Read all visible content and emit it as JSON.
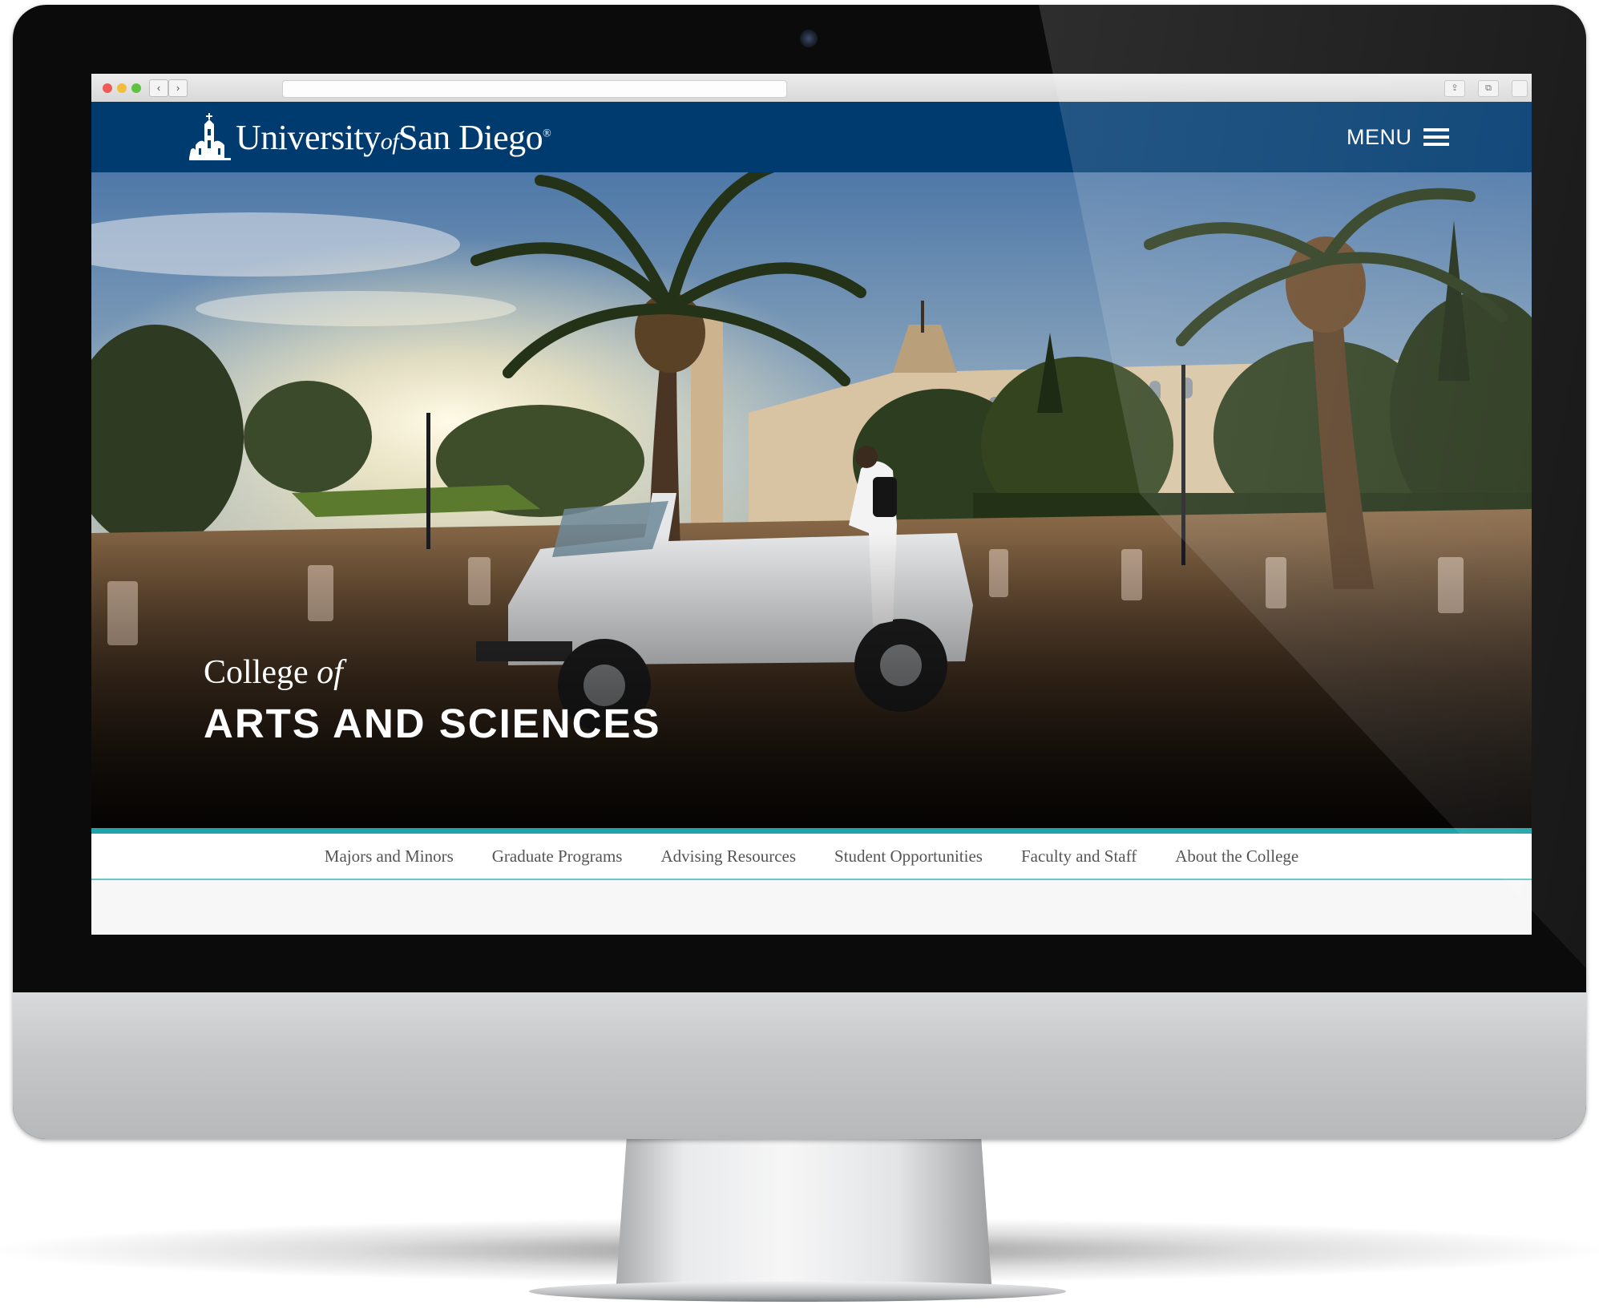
{
  "site": {
    "logo_text_1": "University",
    "logo_text_of": "of",
    "logo_text_2": "San Diego",
    "logo_reg": "®",
    "menu_label": "MENU"
  },
  "browser": {
    "back_icon": "‹",
    "forward_icon": "›",
    "share_icon": "⇪",
    "tabs_icon": "⧉"
  },
  "hero": {
    "subtitle_pre": "College",
    "subtitle_of": "of",
    "title": "ARTS AND SCIENCES"
  },
  "subnav": {
    "items": [
      "Majors and Minors",
      "Graduate Programs",
      "Advising Resources",
      "Student Opportunities",
      "Faculty and Staff",
      "About the College"
    ]
  },
  "colors": {
    "header_bg": "#003b70",
    "accent_teal": "#1fa3a8",
    "subnav_text": "#555555"
  },
  "icons": [
    "usd-logo-icon",
    "hamburger-icon",
    "back-icon",
    "forward-icon",
    "share-icon",
    "tabs-icon"
  ]
}
